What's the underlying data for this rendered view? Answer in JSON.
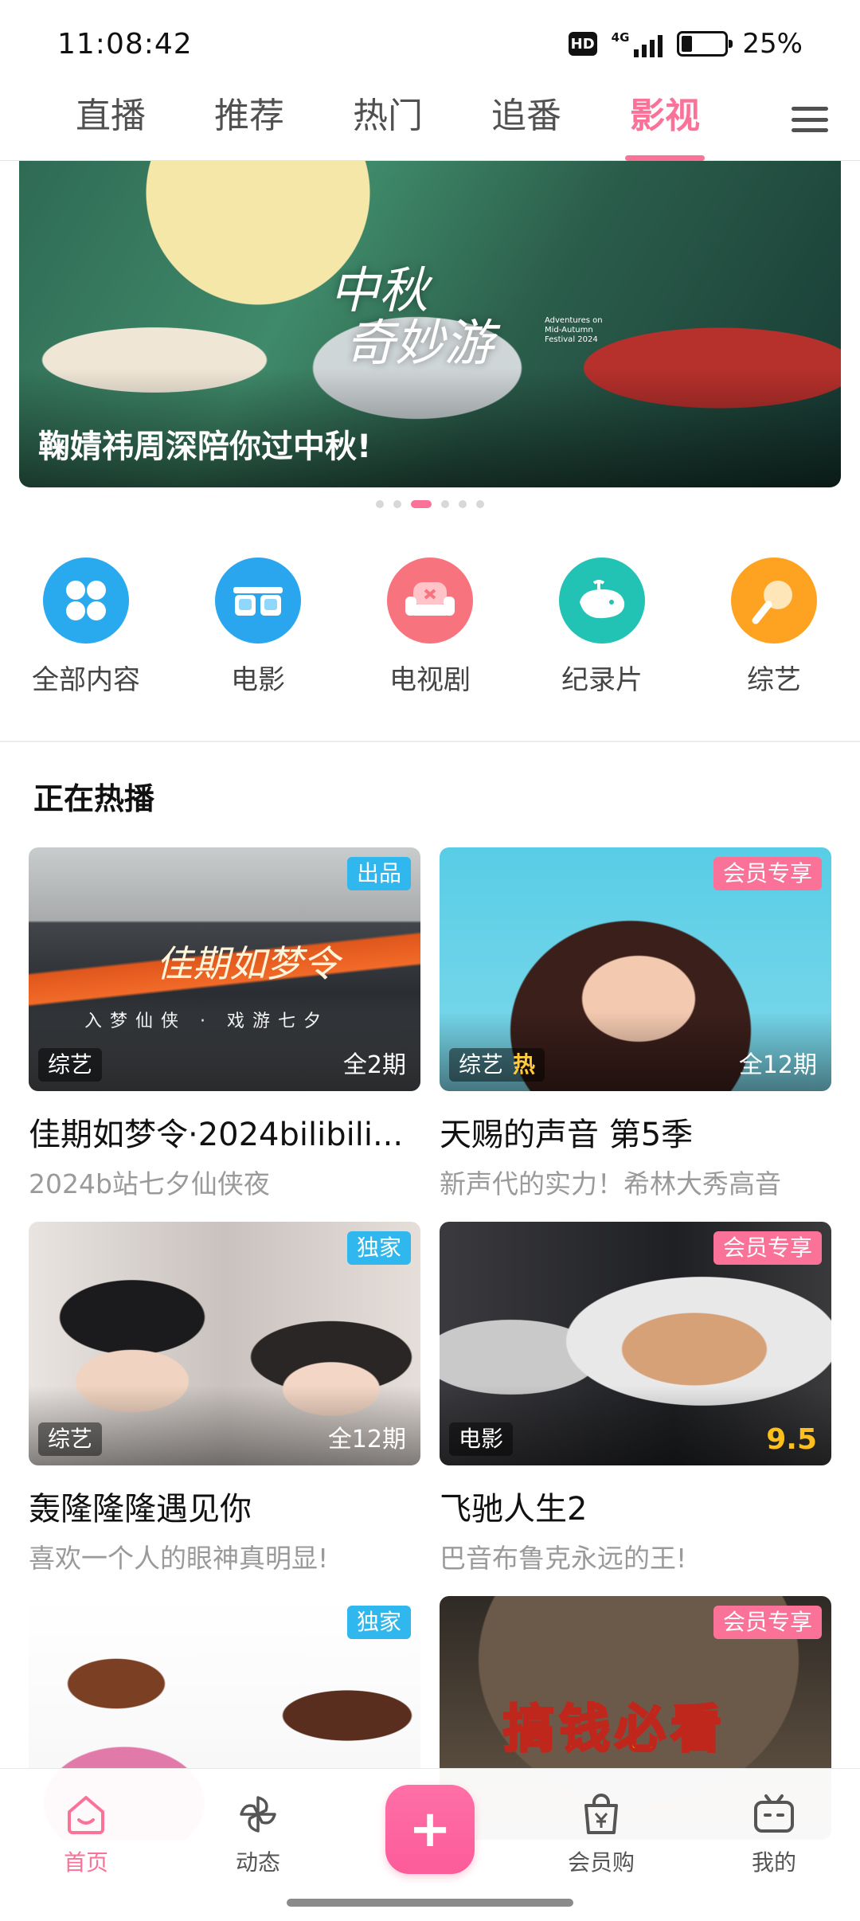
{
  "status_bar": {
    "time": "11:08:42",
    "hd": "HD",
    "network": "4G",
    "battery_text": "25%",
    "battery_level": 0.25
  },
  "top_tabs": [
    {
      "label": "直播",
      "active": false
    },
    {
      "label": "推荐",
      "active": false
    },
    {
      "label": "热门",
      "active": false
    },
    {
      "label": "追番",
      "active": false
    },
    {
      "label": "影视",
      "active": true
    }
  ],
  "banner": {
    "logo_line1": "中秋",
    "logo_line2": "奇妙游",
    "logo_sub": "Adventures on Mid-Autumn Festival 2024",
    "caption": "鞠婧祎周深陪你过中秋!",
    "dots_count": 6,
    "active_dot": 2
  },
  "categories": [
    {
      "label": "全部内容",
      "icon": "grid-icon",
      "color": "#29a9ee"
    },
    {
      "label": "电影",
      "icon": "3d-glasses-icon",
      "color": "#2aa6ee"
    },
    {
      "label": "电视剧",
      "icon": "sofa-icon",
      "color": "#f7737e"
    },
    {
      "label": "纪录片",
      "icon": "whale-icon",
      "color": "#22c3b4"
    },
    {
      "label": "综艺",
      "icon": "microphone-icon",
      "color": "#fea321"
    }
  ],
  "section": {
    "title": "正在热播"
  },
  "cards": [
    {
      "badge": "出品",
      "badge_color": "#2fb7ee",
      "tag": "综艺",
      "hot": "",
      "episodes": "全2期",
      "score": "",
      "title": "佳期如梦令·2024bilibili...",
      "subtitle": "2024b站七夕仙侠夜",
      "art_title": "佳期如梦令",
      "art_sub": "入梦仙侠 · 戏游七夕"
    },
    {
      "badge": "会员专享",
      "badge_color": "#fb7299",
      "tag": "综艺",
      "hot": "热",
      "episodes": "全12期",
      "score": "",
      "title": "天赐的声音 第5季",
      "subtitle": "新声代的实力！希林大秀高音"
    },
    {
      "badge": "独家",
      "badge_color": "#2fb7ee",
      "tag": "综艺",
      "hot": "",
      "episodes": "全12期",
      "score": "",
      "title": "轰隆隆隆遇见你",
      "subtitle": "喜欢一个人的眼神真明显!"
    },
    {
      "badge": "会员专享",
      "badge_color": "#fb7299",
      "tag": "电影",
      "hot": "",
      "episodes": "",
      "score": "9.5",
      "title": "飞驰人生2",
      "subtitle": "巴音布鲁克永远的王!"
    },
    {
      "badge": "独家",
      "badge_color": "#2fb7ee",
      "tag": "",
      "hot": "",
      "episodes": "",
      "score": "",
      "title": "",
      "subtitle": ""
    },
    {
      "badge": "会员专享",
      "badge_color": "#fb7299",
      "tag": "",
      "hot": "",
      "episodes": "",
      "score": "",
      "title": "",
      "subtitle": "",
      "art_title": "搞钱必看"
    }
  ],
  "bottom_nav": {
    "items": [
      {
        "label": "首页",
        "icon": "home-icon",
        "active": true
      },
      {
        "label": "动态",
        "icon": "pinwheel-icon",
        "active": false
      },
      {
        "label": "会员购",
        "icon": "shopping-bag-icon",
        "active": false
      },
      {
        "label": "我的",
        "icon": "tv-icon",
        "active": false
      }
    ],
    "publish_label": "+"
  },
  "colors": {
    "accent": "#fb7299",
    "blue_badge": "#2fb7ee"
  }
}
